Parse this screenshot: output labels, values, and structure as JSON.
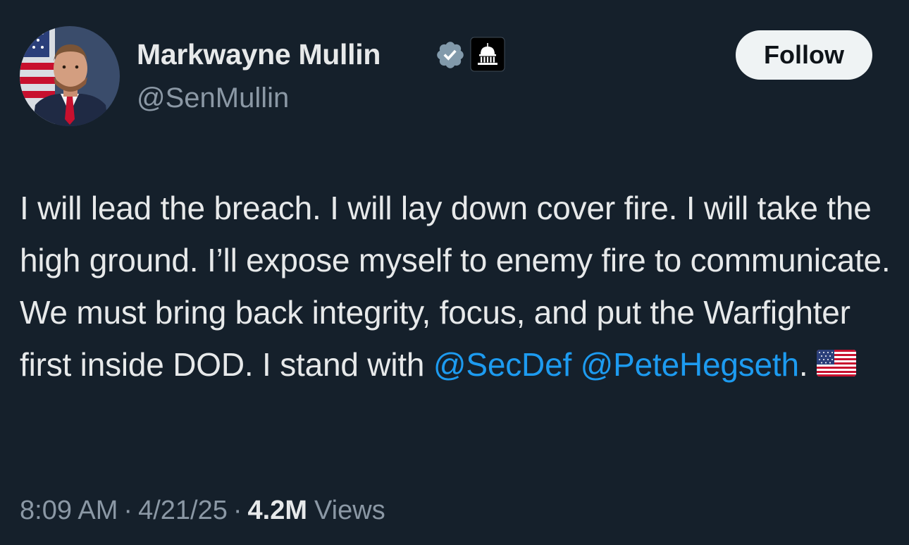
{
  "author": {
    "display_name": "Markwayne Mullin",
    "handle": "@SenMullin",
    "verified_icon": "verified-badge-icon",
    "affiliation_icon": "capitol-building-icon"
  },
  "follow_button": {
    "label": "Follow"
  },
  "tweet": {
    "text_lead": "I will lead the breach. I will lay down cover fire. I will take the high ground. I’ll expose myself to enemy fire to communicate. We must bring back integrity, focus, and put the Warfighter first inside DOD. I stand with ",
    "mention_1": "@SecDef",
    "mention_2": "@PeteHegseth",
    "text_tail": ".",
    "emoji": "us-flag-emoji"
  },
  "meta": {
    "time": "8:09 AM",
    "date": "4/21/25",
    "views_count": "4.2M",
    "views_label": "Views",
    "separator": "·"
  },
  "colors": {
    "background": "#15202b",
    "text_primary": "#e7e9ea",
    "text_secondary": "#8b98a5",
    "link": "#1d9bf0",
    "button_bg": "#eff3f4",
    "button_text": "#0f1419",
    "badge_gray": "#829aab"
  }
}
